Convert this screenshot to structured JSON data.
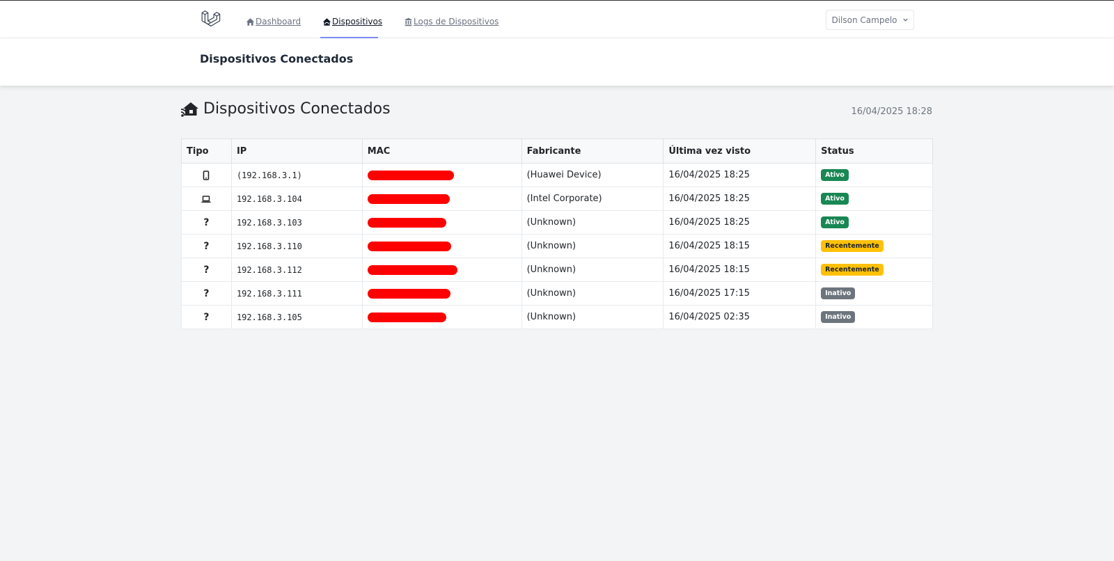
{
  "nav": {
    "links": [
      {
        "label": "Dashboard",
        "icon": "home-icon"
      },
      {
        "label": "Dispositivos",
        "icon": "home-wifi-icon",
        "active": true
      },
      {
        "label": "Logs de Dispositivos",
        "icon": "building-icon"
      }
    ],
    "user": "Dilson Campelo",
    "accent": "#818cf8"
  },
  "header": {
    "title": "Dispositivos Conectados"
  },
  "main": {
    "title": "Dispositivos Conectados",
    "title_icon": "home-wifi-icon",
    "timestamp": "16/04/2025 18:28"
  },
  "table": {
    "columns": [
      "Tipo",
      "IP",
      "MAC",
      "Fabricante",
      "Última vez visto",
      "Status"
    ],
    "rows": [
      {
        "tipo": "smartphone-icon",
        "ip": "(192.168.3.1)",
        "mac": "redacted",
        "fabricante": "(Huawei Device)",
        "visto": "16/04/2025 18:25",
        "status": "Ativo"
      },
      {
        "tipo": "laptop-icon",
        "ip": "192.168.3.104",
        "mac": "redacted",
        "fabricante": "(Intel Corporate)",
        "visto": "16/04/2025 18:25",
        "status": "Ativo"
      },
      {
        "tipo": "?",
        "ip": "192.168.3.103",
        "mac": "redacted",
        "fabricante": "(Unknown)",
        "visto": "16/04/2025 18:25",
        "status": "Ativo"
      },
      {
        "tipo": "?",
        "ip": "192.168.3.110",
        "mac": "redacted",
        "fabricante": "(Unknown)",
        "visto": "16/04/2025 18:15",
        "status": "Recentemente"
      },
      {
        "tipo": "?",
        "ip": "192.168.3.112",
        "mac": "redacted",
        "fabricante": "(Unknown)",
        "visto": "16/04/2025 18:15",
        "status": "Recentemente"
      },
      {
        "tipo": "?",
        "ip": "192.168.3.111",
        "mac": "redacted",
        "fabricante": "(Unknown)",
        "visto": "16/04/2025 17:15",
        "status": "Inativo"
      },
      {
        "tipo": "?",
        "ip": "192.168.3.105",
        "mac": "redacted",
        "fabricante": "(Unknown)",
        "visto": "16/04/2025 02:35",
        "status": "Inativo"
      }
    ],
    "status_colors": {
      "Ativo": "#198754",
      "Recentemente": "#ffc107",
      "Inativo": "#6c757d"
    },
    "ip_color": "#d63384",
    "redaction_color": "#ff0000"
  }
}
